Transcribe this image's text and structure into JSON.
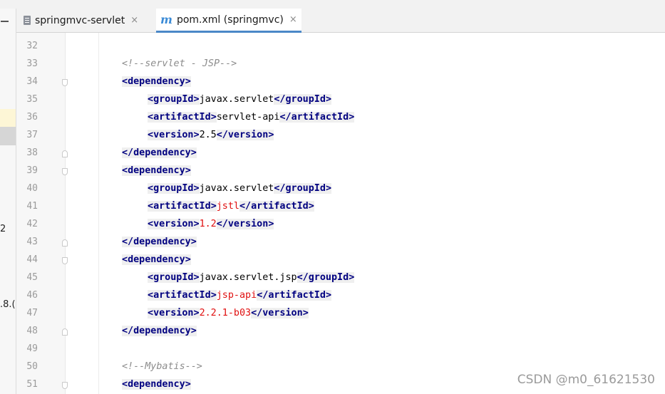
{
  "tabs": [
    {
      "label": "springmvc-servlet",
      "close": "×",
      "active": false,
      "icon": "file-icon"
    },
    {
      "label": "pom.xml (springmvc)",
      "close": "×",
      "active": true,
      "icon": "maven-icon",
      "icon_glyph": "m"
    }
  ],
  "left_fragments": [
    "2",
    ".8.("
  ],
  "lines": [
    {
      "n": "32",
      "kind": "blank"
    },
    {
      "n": "33",
      "kind": "comment",
      "text": "<!--servlet - JSP-->"
    },
    {
      "n": "34",
      "kind": "open",
      "tag": "dependency",
      "fold": "open"
    },
    {
      "n": "35",
      "kind": "elem",
      "tag": "groupId",
      "value": "javax.servlet",
      "red": false
    },
    {
      "n": "36",
      "kind": "elem",
      "tag": "artifactId",
      "value": "servlet-api",
      "red": false
    },
    {
      "n": "37",
      "kind": "elem",
      "tag": "version",
      "value": "2.5",
      "red": false
    },
    {
      "n": "38",
      "kind": "close",
      "tag": "dependency",
      "fold": "close"
    },
    {
      "n": "39",
      "kind": "open",
      "tag": "dependency",
      "fold": "open"
    },
    {
      "n": "40",
      "kind": "elem",
      "tag": "groupId",
      "value": "javax.servlet",
      "red": false
    },
    {
      "n": "41",
      "kind": "elem",
      "tag": "artifactId",
      "value": "jstl",
      "red": true
    },
    {
      "n": "42",
      "kind": "elem",
      "tag": "version",
      "value": "1.2",
      "red": true
    },
    {
      "n": "43",
      "kind": "close",
      "tag": "dependency",
      "fold": "close"
    },
    {
      "n": "44",
      "kind": "open",
      "tag": "dependency",
      "fold": "open"
    },
    {
      "n": "45",
      "kind": "elem",
      "tag": "groupId",
      "value": "javax.servlet.jsp",
      "red": false
    },
    {
      "n": "46",
      "kind": "elem",
      "tag": "artifactId",
      "value": "jsp-api",
      "red": true
    },
    {
      "n": "47",
      "kind": "elem",
      "tag": "version",
      "value": "2.2.1-b03",
      "red": true
    },
    {
      "n": "48",
      "kind": "close",
      "tag": "dependency",
      "fold": "close"
    },
    {
      "n": "49",
      "kind": "blank"
    },
    {
      "n": "50",
      "kind": "comment",
      "text": "<!--Mybatis-->"
    },
    {
      "n": "51",
      "kind": "open",
      "tag": "dependency",
      "fold": "open"
    }
  ],
  "watermark": "CSDN @m0_61621530"
}
